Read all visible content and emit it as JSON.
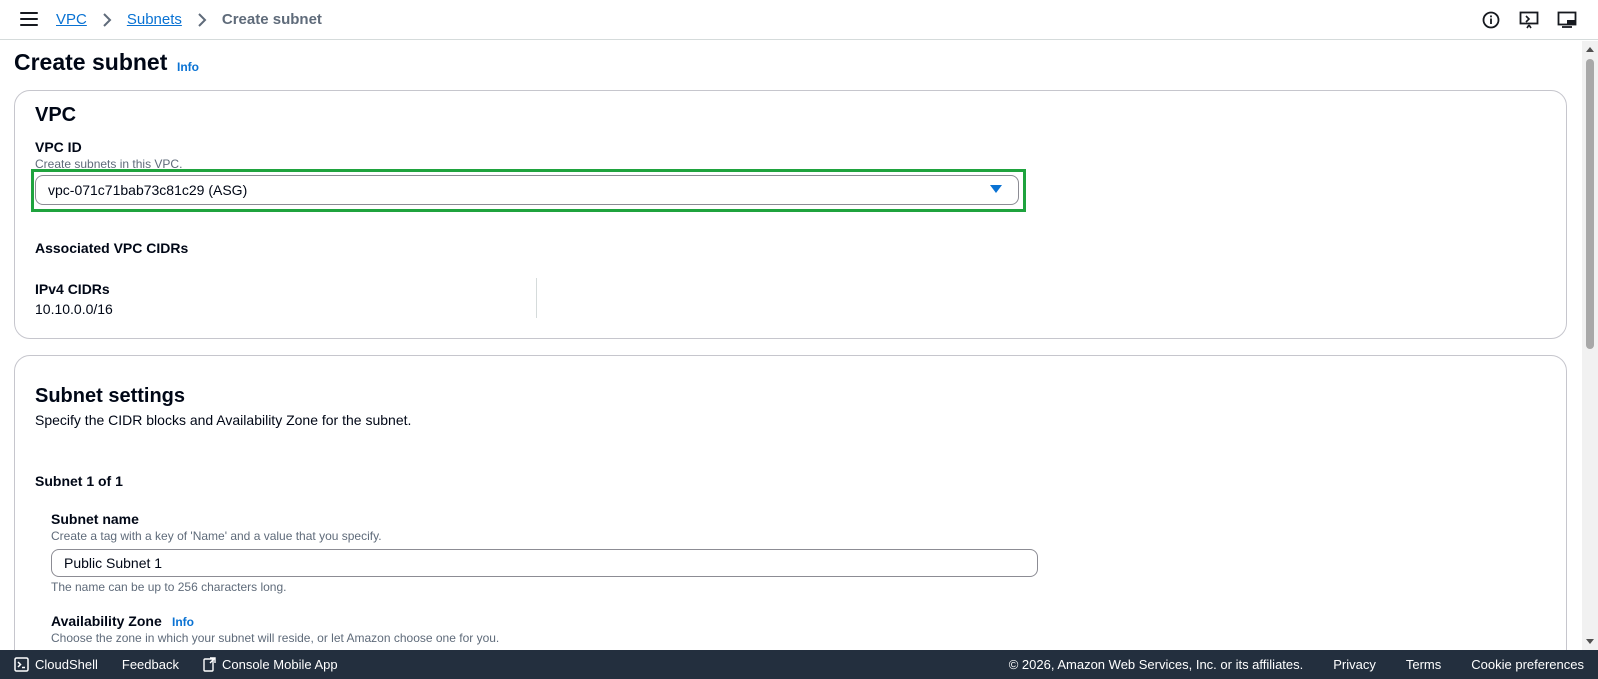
{
  "header": {
    "breadcrumbs": [
      "VPC",
      "Subnets"
    ],
    "current": "Create subnet"
  },
  "page": {
    "title": "Create subnet",
    "info": "Info"
  },
  "vpc_panel": {
    "title": "VPC",
    "vpc_id_label": "VPC ID",
    "vpc_id_desc": "Create subnets in this VPC.",
    "vpc_id_value": "vpc-071c71bab73c81c29 (ASG)",
    "assoc_label": "Associated VPC CIDRs",
    "ipv4_label": "IPv4 CIDRs",
    "ipv4_value": "10.10.0.0/16"
  },
  "subnet_panel": {
    "title": "Subnet settings",
    "desc": "Specify the CIDR blocks and Availability Zone for the subnet.",
    "counter": "Subnet 1 of 1",
    "name_label": "Subnet name",
    "name_desc": "Create a tag with a key of 'Name' and a value that you specify.",
    "name_value": "Public Subnet 1",
    "name_hint": "The name can be up to 256 characters long.",
    "az_label": "Availability Zone",
    "az_info": "Info",
    "az_desc": "Choose the zone in which your subnet will reside, or let Amazon choose one for you."
  },
  "footer": {
    "cloudshell": "CloudShell",
    "feedback": "Feedback",
    "mobile": "Console Mobile App",
    "copyright": "© 2026, Amazon Web Services, Inc. or its affiliates.",
    "privacy": "Privacy",
    "terms": "Terms",
    "cookies": "Cookie preferences"
  },
  "colors": {
    "link": "#0972d3",
    "highlight": "#1fa33e",
    "footer_bg": "#232f3e"
  }
}
